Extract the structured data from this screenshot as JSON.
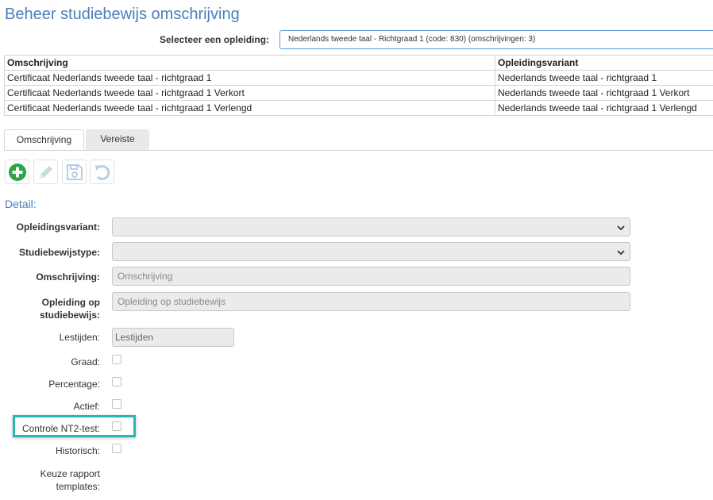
{
  "page": {
    "title": "Beheer studiebewijs omschrijving",
    "select_label": "Selecteer een opleiding:",
    "select_value": "Nederlands tweede taal - Richtgraad 1 (code: 830) (omschrijvingen: 3)"
  },
  "table": {
    "headers": [
      "Omschrijving",
      "Opleidingsvariant"
    ],
    "rows": [
      [
        "Certificaat Nederlands tweede taal - richtgraad 1",
        "Nederlands tweede taal - richtgraad 1"
      ],
      [
        "Certificaat Nederlands tweede taal - richtgraad 1 Verkort",
        "Nederlands tweede taal - richtgraad 1 Verkort"
      ],
      [
        "Certificaat Nederlands tweede taal - richtgraad 1 Verlengd",
        "Nederlands tweede taal - richtgraad 1 Verlengd"
      ]
    ]
  },
  "tabs": [
    {
      "label": "Omschrijving",
      "active": true
    },
    {
      "label": "Vereiste",
      "active": false
    }
  ],
  "toolbar": {
    "icons": [
      "add-icon",
      "edit-icon",
      "save-icon",
      "undo-icon"
    ],
    "add_color": "#28a745"
  },
  "detail": {
    "heading": "Detail:",
    "fields": {
      "opleidingsvariant": {
        "label": "Opleidingsvariant:",
        "value": ""
      },
      "studiebewijstype": {
        "label": "Studiebewijstype:",
        "value": ""
      },
      "omschrijving": {
        "label": "Omschrijving:",
        "placeholder": "Omschrijving"
      },
      "opleiding_op_studiebewijs": {
        "label_line1": "Opleiding op",
        "label_line2": "studiebewijs:",
        "placeholder": "Opleiding op studiebewijs"
      },
      "lestijden": {
        "label": "Lestijden:",
        "placeholder": "Lestijden"
      },
      "graad": {
        "label": "Graad:",
        "checked": false
      },
      "percentage": {
        "label": "Percentage:",
        "checked": false
      },
      "actief": {
        "label": "Actief:",
        "checked": false
      },
      "controle_nt2": {
        "label": "Controle NT2-test:",
        "checked": false
      },
      "historisch": {
        "label": "Historisch:",
        "checked": false
      },
      "keuze_rapport": {
        "label_line1": "Keuze rapport",
        "label_line2": "templates:"
      }
    }
  },
  "colors": {
    "title": "#4a7fb8",
    "highlight": "#2ab5b0",
    "select_border": "#5b9bd5"
  }
}
